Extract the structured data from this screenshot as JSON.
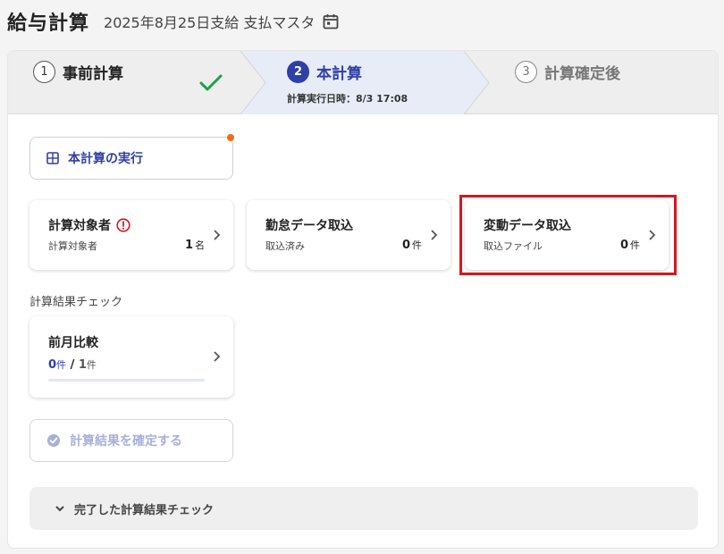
{
  "header": {
    "title": "給与計算",
    "subtitle": "2025年8月25日支給 支払マスタ"
  },
  "stepper": {
    "steps": [
      {
        "number": "1",
        "label": "事前計算",
        "state": "completed"
      },
      {
        "number": "2",
        "label": "本計算",
        "state": "active",
        "meta": "計算実行日時：8/3 17:08"
      },
      {
        "number": "3",
        "label": "計算確定後",
        "state": "upcoming"
      }
    ]
  },
  "actions": {
    "run_label": "本計算の実行"
  },
  "cards": [
    {
      "title": "計算対象者",
      "sub": "計算対象者",
      "count": "1",
      "unit": "名",
      "warning": true
    },
    {
      "title": "勤怠データ取込",
      "sub": "取込済み",
      "count": "0",
      "unit": "件"
    },
    {
      "title": "変動データ取込",
      "sub": "取込ファイル",
      "count": "0",
      "unit": "件",
      "highlighted": true
    }
  ],
  "check_section": {
    "label": "計算結果チェック",
    "compare": {
      "title": "前月比較",
      "done": "0",
      "done_unit": "件",
      "separator": "/",
      "total": "1",
      "total_unit": "件",
      "progress": 0
    }
  },
  "confirm": {
    "label": "計算結果を確定する"
  },
  "collapse": {
    "label": "完了した計算結果チェック"
  },
  "colors": {
    "accent": "#2f3fa8",
    "success": "#1e9e4a",
    "warning": "#d8161d",
    "notification": "#f26b0f",
    "highlight_border": "#d8161d"
  }
}
